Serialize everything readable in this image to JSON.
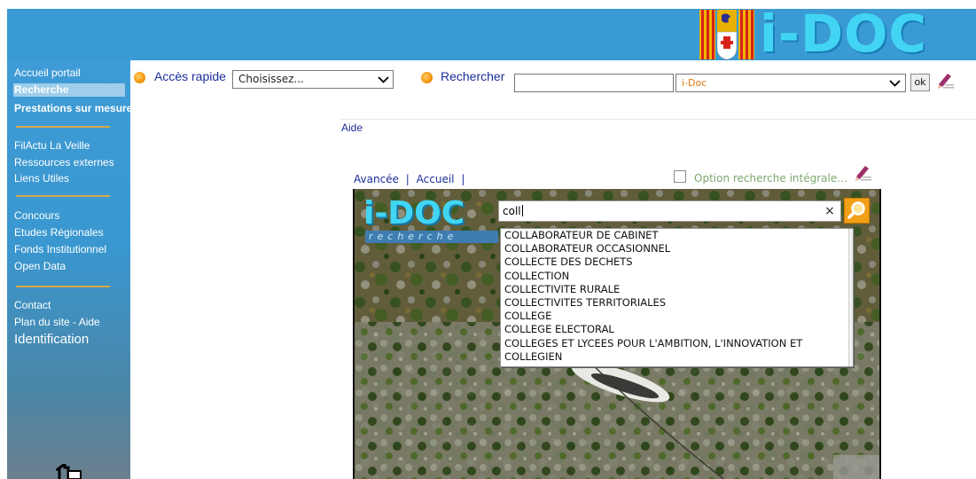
{
  "header": {
    "logo_text": "i-DOC",
    "colors": {
      "banner": "#3a9ad4",
      "logo": "#42d5f3"
    }
  },
  "sidebar": {
    "groups": [
      [
        "Accueil portail",
        "Recherche",
        "Prestations sur mesure"
      ],
      [
        "FilActu La Veille",
        "Ressources externes",
        "Liens Utiles"
      ],
      [
        "Concours",
        "Etudes Régionales",
        "Fonds Institutionnel",
        "Open Data"
      ],
      [
        "Contact",
        "Plan du site - Aide",
        "Identification"
      ]
    ],
    "active_item": "Recherche"
  },
  "toolbar": {
    "quick_access_label": "Accès rapide",
    "quick_access_selected": "Choisissez...",
    "search_label": "Rechercher",
    "search_value": "",
    "scope_selected": "i-Doc",
    "ok_label": "ok"
  },
  "help_link": "Aide",
  "subnav": {
    "advanced": "Avancée",
    "separator": "|",
    "home": "Accueil",
    "fulltext_option": "Option recherche intégrale...",
    "fulltext_checked": false
  },
  "search_panel": {
    "logo_text": "i-DOC",
    "logo_subtitle": "recherche",
    "query": "coll",
    "clear_glyph": "×",
    "suggestions": [
      "COLLABORATEUR DE CABINET",
      "COLLABORATEUR OCCASIONNEL",
      "COLLECTE DES DECHETS",
      "COLLECTION",
      "COLLECTIVITE RURALE",
      "COLLECTIVITES TERRITORIALES",
      "COLLEGE",
      "COLLEGE ELECTORAL",
      "COLLEGES ET LYCEES POUR L'AMBITION, L'INNOVATION ET",
      "COLLEGIEN"
    ]
  },
  "icons": {
    "quick_access": "orange-bullet-icon",
    "search": "orange-bullet-icon",
    "edit": "pencil-icon",
    "go": "magnifier-icon",
    "home": "home-icon"
  }
}
